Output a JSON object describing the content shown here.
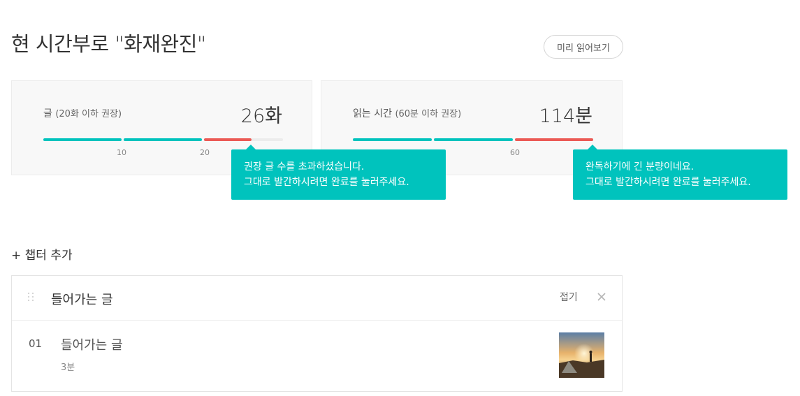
{
  "page": {
    "title": "현 시간부로 \"화재완진\"",
    "preview_label": "미리 읽어보기"
  },
  "stats": [
    {
      "label": "글",
      "hint": "(20화 이하 권장)",
      "value": "26화",
      "progress_value": 26,
      "recommended_max": 20,
      "ticks": [
        "10",
        "20"
      ],
      "tooltip": [
        "권장 글 수를 초과하셨습니다.",
        "그대로 발간하시려면 완료를 눌러주세요."
      ]
    },
    {
      "label": "읽는 시간",
      "hint": "(60분 이하 권장)",
      "value": "114분",
      "progress_value": 114,
      "recommended_max": 60,
      "ticks": [
        "60"
      ],
      "tooltip": [
        "완독하기에 긴 분량이네요.",
        "그대로 발간하시려면 완료를 눌러주세요."
      ]
    }
  ],
  "add_chapter_label": "+ 챕터 추가",
  "chapter": {
    "title": "들어가는 글",
    "fold_label": "접기",
    "close_icon": "close-icon",
    "drag_icon": "drag-handle-icon",
    "items": [
      {
        "number": "01",
        "title": "들어가는 글",
        "read_time": "3분",
        "thumbnail": "sunset-camping-photo"
      }
    ]
  },
  "colors": {
    "accent": "#00c3bd",
    "warning": "#eb5a55",
    "card_bg": "#f8f8f8"
  }
}
